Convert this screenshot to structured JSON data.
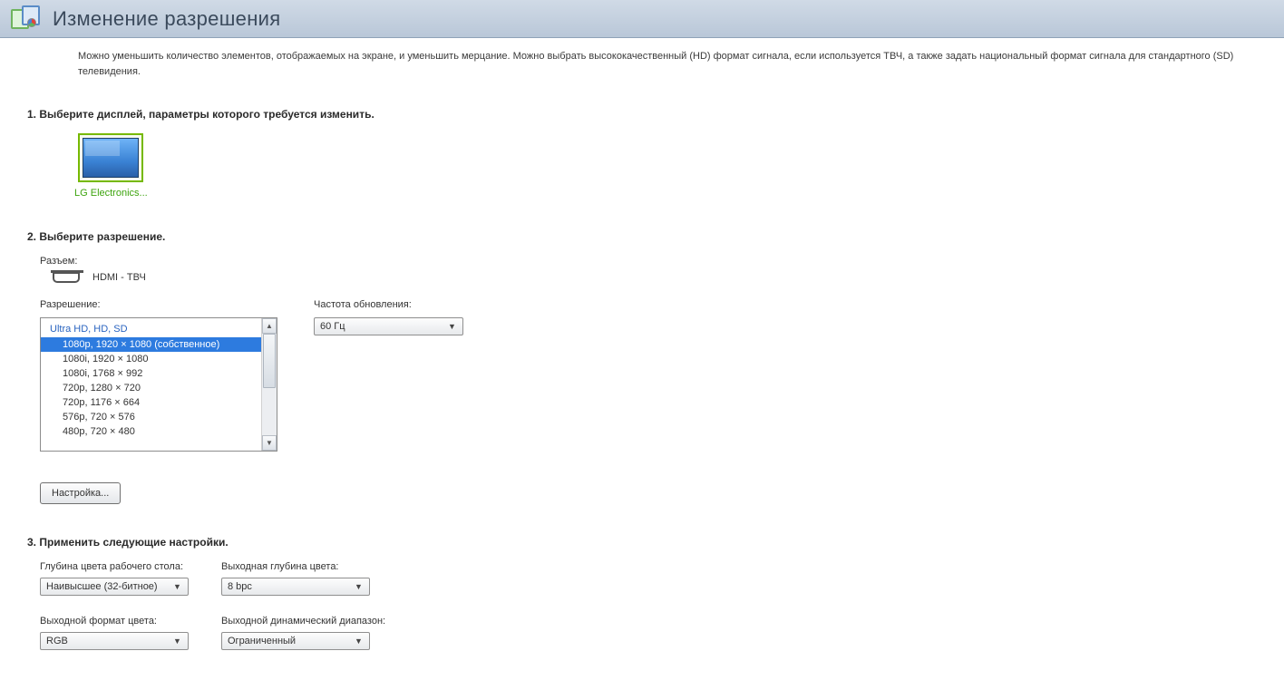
{
  "header": {
    "title": "Изменение разрешения"
  },
  "description": "Можно уменьшить количество элементов, отображаемых на экране, и уменьшить мерцание. Можно выбрать высококачественный (HD) формат сигнала, если используется ТВЧ, а также задать национальный формат сигнала для стандартного (SD) телевидения.",
  "section1": {
    "title": "1. Выберите дисплей, параметры которого требуется изменить.",
    "display_label": "LG Electronics..."
  },
  "section2": {
    "title": "2. Выберите разрешение.",
    "connector_label": "Разъем:",
    "connector_value": "HDMI - ТВЧ",
    "resolution_label": "Разрешение:",
    "refresh_label": "Частота обновления:",
    "refresh_value": "60 Гц",
    "group_label": "Ultra HD, HD, SD",
    "items": [
      "1080p, 1920 × 1080 (собственное)",
      "1080i, 1920 × 1080",
      "1080i, 1768 × 992",
      "720p, 1280 × 720",
      "720p, 1176 × 664",
      "576p, 720 × 576",
      "480p, 720 × 480"
    ],
    "customize_btn": "Настройка..."
  },
  "section3": {
    "title": "3. Применить следующие настройки.",
    "desktop_depth_label": "Глубина цвета рабочего стола:",
    "desktop_depth_value": "Наивысшее (32-битное)",
    "output_depth_label": "Выходная глубина цвета:",
    "output_depth_value": "8 bpc",
    "output_format_label": "Выходной формат цвета:",
    "output_format_value": "RGB",
    "dynamic_range_label": "Выходной динамический диапазон:",
    "dynamic_range_value": "Ограниченный"
  }
}
